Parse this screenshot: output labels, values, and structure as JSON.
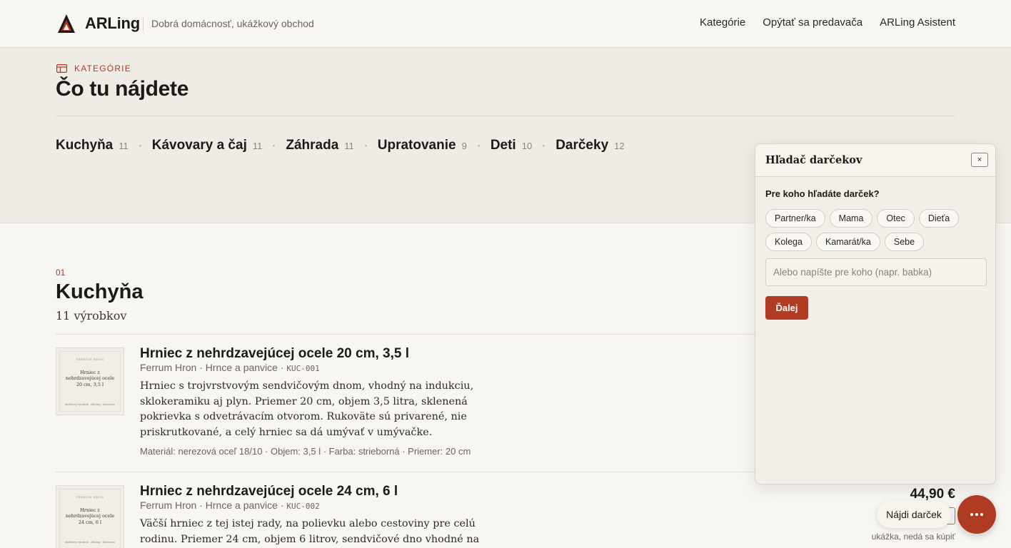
{
  "header": {
    "brand": "ARLing",
    "tagline": "Dobrá domácnosť, ukážkový obchod",
    "nav": [
      "Kategórie",
      "Opýtať sa predavača",
      "ARLing Asistent"
    ],
    "accent_color": "#b13a22"
  },
  "categories_band": {
    "eyebrow": "KATEGÓRIE",
    "title": "Čo tu nájdete",
    "items": [
      {
        "name": "Kuchyňa",
        "count": "11"
      },
      {
        "name": "Kávovary a čaj",
        "count": "11"
      },
      {
        "name": "Záhrada",
        "count": "11"
      },
      {
        "name": "Upratovanie",
        "count": "9"
      },
      {
        "name": "Deti",
        "count": "10"
      },
      {
        "name": "Darčeky",
        "count": "12"
      }
    ]
  },
  "section": {
    "number": "01",
    "title": "Kuchyňa",
    "count": "11 výrobkov"
  },
  "products": [
    {
      "name": "Hrniec z nehrdzavejúcej ocele 20 cm, 3,5 l",
      "meta": "Ferrum Hron · Hrnce a panvice · ",
      "sku": "KUC-001",
      "description": "Hrniec s trojvrstvovým sendvičovým dnom, vhodný na indukciu, sklokeramiku aj plyn. Priemer 20 cm, objem 3,5 litra, sklenená pokrievka s odvetrávacím otvorom. Rukoväte sú privarené, nie priskrutkované, a celý hrniec sa dá umývať v umývačke.",
      "attributes": "Materiál: nerezová oceľ 18/10 · Objem: 3,5 l · Farba: strieborná · Priemer: 20 cm",
      "thumb_brand": "FERRUM HRON",
      "thumb_title": "Hrniec z nehrdzavejúcej ocele 20 cm, 3,5 l",
      "thumb_footer": "ukážkový výrobok · ARLing · ilustrácia"
    },
    {
      "name": "Hrniec z nehrdzavejúcej ocele 24 cm, 6 l",
      "meta": "Ferrum Hron · Hrnce a panvice · ",
      "sku": "KUC-002",
      "description": "Väčší hrniec z tej istej rady, na polievku alebo cestoviny pre celú rodinu. Priemer 24 cm, objem 6 litrov, sendvičové dno vhodné na indukciu,",
      "thumb_brand": "FERRUM HRON",
      "thumb_title": "Hrniec z nehrdzavejúcej ocele 24 cm, 6 l",
      "thumb_footer": "ukážkový výrobok · ARLing · ilustrácia",
      "price": "44,90 €",
      "price_note": "ukážka, nedá sa kúpiť"
    }
  ],
  "gift_panel": {
    "title": "Hľadač darčekov",
    "close": "×",
    "question": "Pre koho hľadáte darček?",
    "chips": [
      "Partner/ka",
      "Mama",
      "Otec",
      "Dieťa",
      "Kolega",
      "Kamarát/ka",
      "Sebe"
    ],
    "input_placeholder": "Alebo napíšte pre koho (napr. babka)",
    "next_button": "Ďalej"
  },
  "floating": {
    "find_gift": "Nájdi darček",
    "chat_icon": "more-dots-icon"
  }
}
